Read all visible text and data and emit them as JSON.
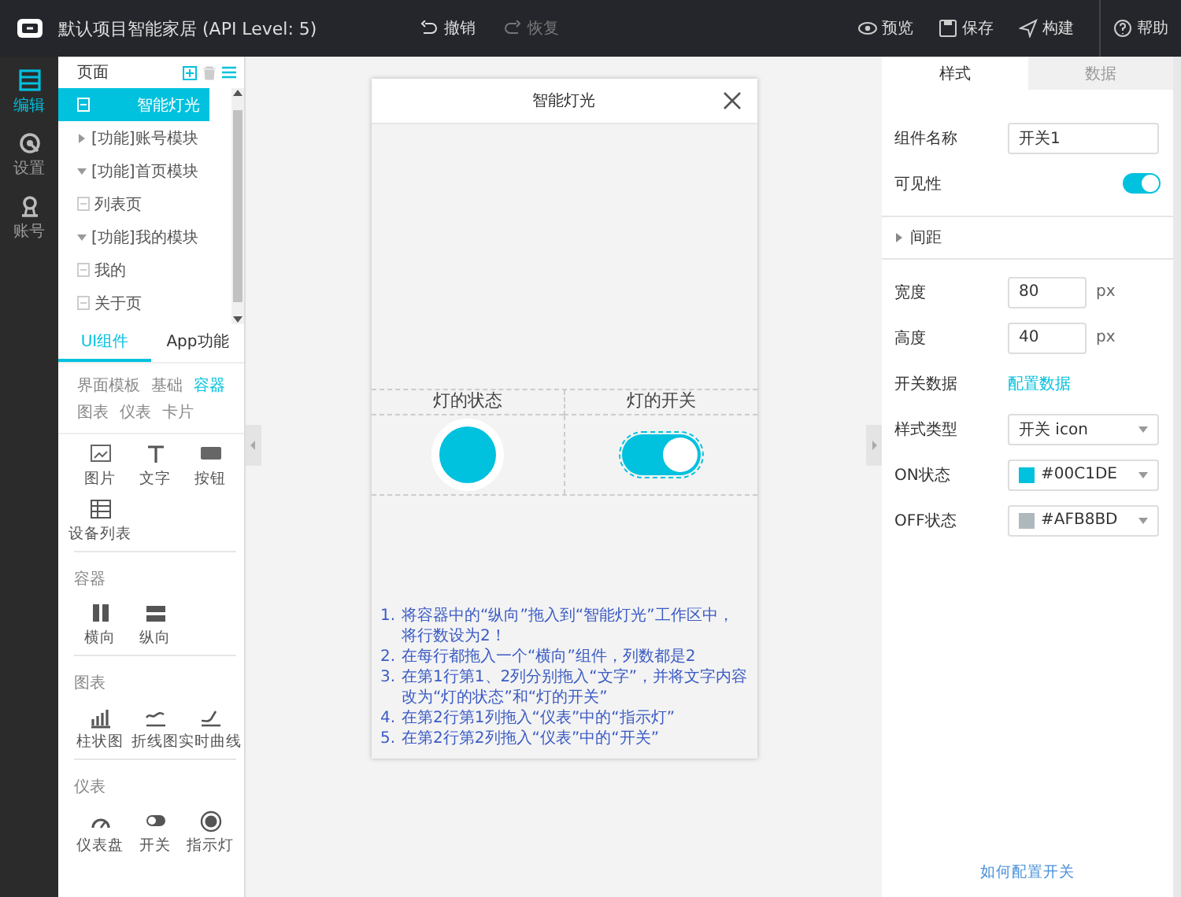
{
  "app_bar": {
    "title": "默认项目智能家居 (API Level: 5)",
    "history": [
      {
        "label": "撤销",
        "disabled": false
      },
      {
        "label": "恢复",
        "disabled": true
      }
    ],
    "actions": [
      {
        "label": "预览"
      },
      {
        "label": "保存"
      },
      {
        "label": "构建"
      },
      {
        "label": "帮助"
      }
    ]
  },
  "nav_rail": [
    {
      "label": "编辑",
      "selected": true
    },
    {
      "label": "设置",
      "selected": false
    },
    {
      "label": "账号",
      "selected": false
    }
  ],
  "pages_panel": {
    "title": "页面",
    "tree": [
      {
        "label": "智能灯光",
        "kind": "page",
        "selected": true
      },
      {
        "label": "[功能]账号模块",
        "kind": "group",
        "selected": false,
        "expanded": false
      },
      {
        "label": "[功能]首页模块",
        "kind": "group",
        "selected": false,
        "expanded": true,
        "children": [
          {
            "label": "列表页",
            "kind": "page",
            "selected": false
          }
        ]
      },
      {
        "label": "[功能]我的模块",
        "kind": "group",
        "selected": false,
        "expanded": true,
        "children": [
          {
            "label": "我的",
            "kind": "page",
            "selected": false
          },
          {
            "label": "关于页",
            "kind": "page",
            "selected": false
          }
        ]
      }
    ]
  },
  "component_tabs": [
    {
      "label": "UI组件",
      "selected": true
    },
    {
      "label": "App功能",
      "selected": false
    }
  ],
  "categories": [
    {
      "label": "界面模板",
      "selected": false
    },
    {
      "label": "基础",
      "selected": false
    },
    {
      "label": "容器",
      "selected": true
    },
    {
      "label": "图表",
      "selected": false
    },
    {
      "label": "仪表",
      "selected": false
    },
    {
      "label": "卡片",
      "selected": false
    }
  ],
  "palette": [
    {
      "items": [
        {
          "label": "图片"
        },
        {
          "label": "文字"
        },
        {
          "label": "按钮"
        },
        {
          "label": "设备列表"
        }
      ]
    },
    {
      "title": "容器",
      "items": [
        {
          "label": "横向"
        },
        {
          "label": "纵向"
        }
      ]
    },
    {
      "title": "图表",
      "items": [
        {
          "label": "柱状图"
        },
        {
          "label": "折线图"
        },
        {
          "label": "实时曲线"
        }
      ]
    },
    {
      "title": "仪表",
      "items": [
        {
          "label": "仪表盘"
        },
        {
          "label": "开关"
        },
        {
          "label": "指示灯"
        }
      ]
    }
  ],
  "phone": {
    "title": "智能灯光",
    "columns": [
      "灯的状态",
      "灯的开关"
    ],
    "indicator": {
      "on": true
    },
    "switch": {
      "on": true
    },
    "instructions": [
      {
        "number": "1.",
        "text": "将容器中的“纵向”拖入到“智能灯光”工作区中，将行数设为2！"
      },
      {
        "number": "2.",
        "text": "在每行都拖入一个“横向”组件，列数都是2"
      },
      {
        "number": "3.",
        "text": "在第1行第1、2列分别拖入“文字”，并将文字内容改为“灯的状态”和“灯的开关”"
      },
      {
        "number": "4.",
        "text": "在第2行第1列拖入“仪表”中的“指示灯”"
      },
      {
        "number": "5.",
        "text": "在第2行第2列拖入“仪表”中的“开关”"
      }
    ]
  },
  "properties": {
    "tabs": [
      {
        "label": "样式",
        "selected": true
      },
      {
        "label": "数据",
        "selected": false
      }
    ],
    "fields": [
      {
        "kind": "text",
        "label": "组件名称",
        "value": "开关1"
      },
      {
        "kind": "toggle",
        "label": "可见性",
        "on": true
      },
      {
        "kind": "section",
        "label": "间距",
        "expanded": false
      },
      {
        "kind": "number",
        "label": "宽度",
        "value": "80",
        "unit": "px"
      },
      {
        "kind": "number",
        "label": "高度",
        "value": "40",
        "unit": "px"
      },
      {
        "kind": "link",
        "label": "开关数据",
        "value": "配置数据"
      },
      {
        "kind": "select",
        "label": "样式类型",
        "value": "开关 icon"
      },
      {
        "kind": "color",
        "label": "ON状态",
        "value": "#00C1DE",
        "color": "#00c1de"
      },
      {
        "kind": "color",
        "label": "OFF状态",
        "value": "#AFB8BD",
        "color": "#afb8bd"
      }
    ],
    "help_link": "如何配置开关"
  }
}
